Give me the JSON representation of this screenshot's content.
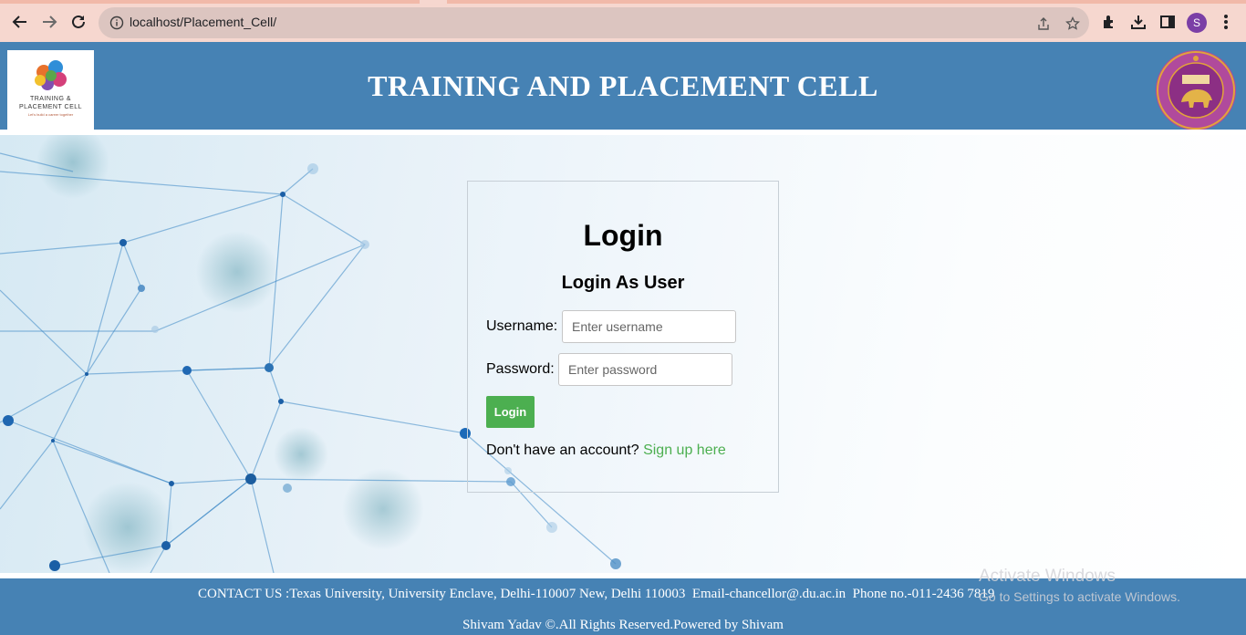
{
  "browser": {
    "url": "localhost/Placement_Cell/",
    "profile_initial": "S",
    "icons": [
      "back-arrow-icon",
      "forward-arrow-icon",
      "reload-icon",
      "info-icon",
      "share-icon",
      "star-icon",
      "extensions-icon",
      "download-icon",
      "side-panel-icon",
      "menu-dots-icon"
    ]
  },
  "header": {
    "title": "TRAINING AND PLACEMENT CELL",
    "logo_line1": "TRAINING &",
    "logo_line2": "PLACEMENT CELL",
    "logo_tagline": "Let's build a career together"
  },
  "login": {
    "heading": "Login",
    "subheading": "Login As User",
    "username_label": "Username:",
    "username_placeholder": "Enter username",
    "password_label": "Password:",
    "password_placeholder": "Enter password",
    "button_label": "Login",
    "signup_prompt": "Don't have an account?",
    "signup_link": "Sign up here"
  },
  "footer": {
    "contact": "CONTACT US :Texas University, University Enclave, Delhi-110007 New, Delhi 110003  Email-chancellor@.du.ac.in  Phone no.-011-2436 7819",
    "copyright": "Shivam Yadav ©.All Rights Reserved.Powered by Shivam"
  },
  "overlay": {
    "activate_title": "Activate Windows",
    "activate_sub": "Go to Settings to activate Windows."
  },
  "colors": {
    "header_bg": "#4682b4",
    "button_green": "#4caf50",
    "chrome_bg": "#f6d7cf"
  }
}
